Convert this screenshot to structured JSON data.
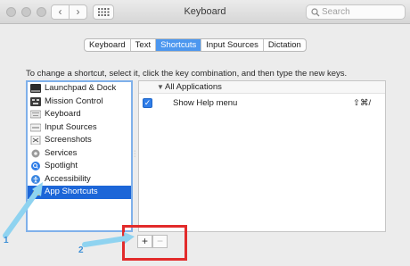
{
  "window": {
    "title": "Keyboard"
  },
  "search": {
    "placeholder": "Search"
  },
  "tabs": [
    {
      "label": "Keyboard",
      "active": false
    },
    {
      "label": "Text",
      "active": false
    },
    {
      "label": "Shortcuts",
      "active": true
    },
    {
      "label": "Input Sources",
      "active": false
    },
    {
      "label": "Dictation",
      "active": false
    }
  ],
  "instruction": "To change a shortcut, select it, click the key combination, and then type the new keys.",
  "categories": [
    {
      "label": "Launchpad & Dock",
      "icon": "launchpad-icon",
      "selected": false
    },
    {
      "label": "Mission Control",
      "icon": "mission-control-icon",
      "selected": false
    },
    {
      "label": "Keyboard",
      "icon": "keyboard-icon",
      "selected": false
    },
    {
      "label": "Input Sources",
      "icon": "input-sources-icon",
      "selected": false
    },
    {
      "label": "Screenshots",
      "icon": "screenshots-icon",
      "selected": false
    },
    {
      "label": "Services",
      "icon": "services-icon",
      "selected": false
    },
    {
      "label": "Spotlight",
      "icon": "spotlight-icon",
      "selected": false
    },
    {
      "label": "Accessibility",
      "icon": "accessibility-icon",
      "selected": false
    },
    {
      "label": "App Shortcuts",
      "icon": "app-shortcuts-icon",
      "selected": true
    }
  ],
  "shortcuts": {
    "group_label": "All Applications",
    "items": [
      {
        "name": "Show Help menu",
        "keys": "⇧⌘/",
        "checked": true
      }
    ]
  },
  "buttons": {
    "add": "+",
    "remove": "−"
  },
  "annotations": {
    "step1": "1",
    "step2": "2"
  },
  "colors": {
    "accent": "#1c66d8",
    "tab_active": "#4c97ef",
    "highlight_box": "#e22b2b",
    "annotation": "#3c8fd6"
  }
}
